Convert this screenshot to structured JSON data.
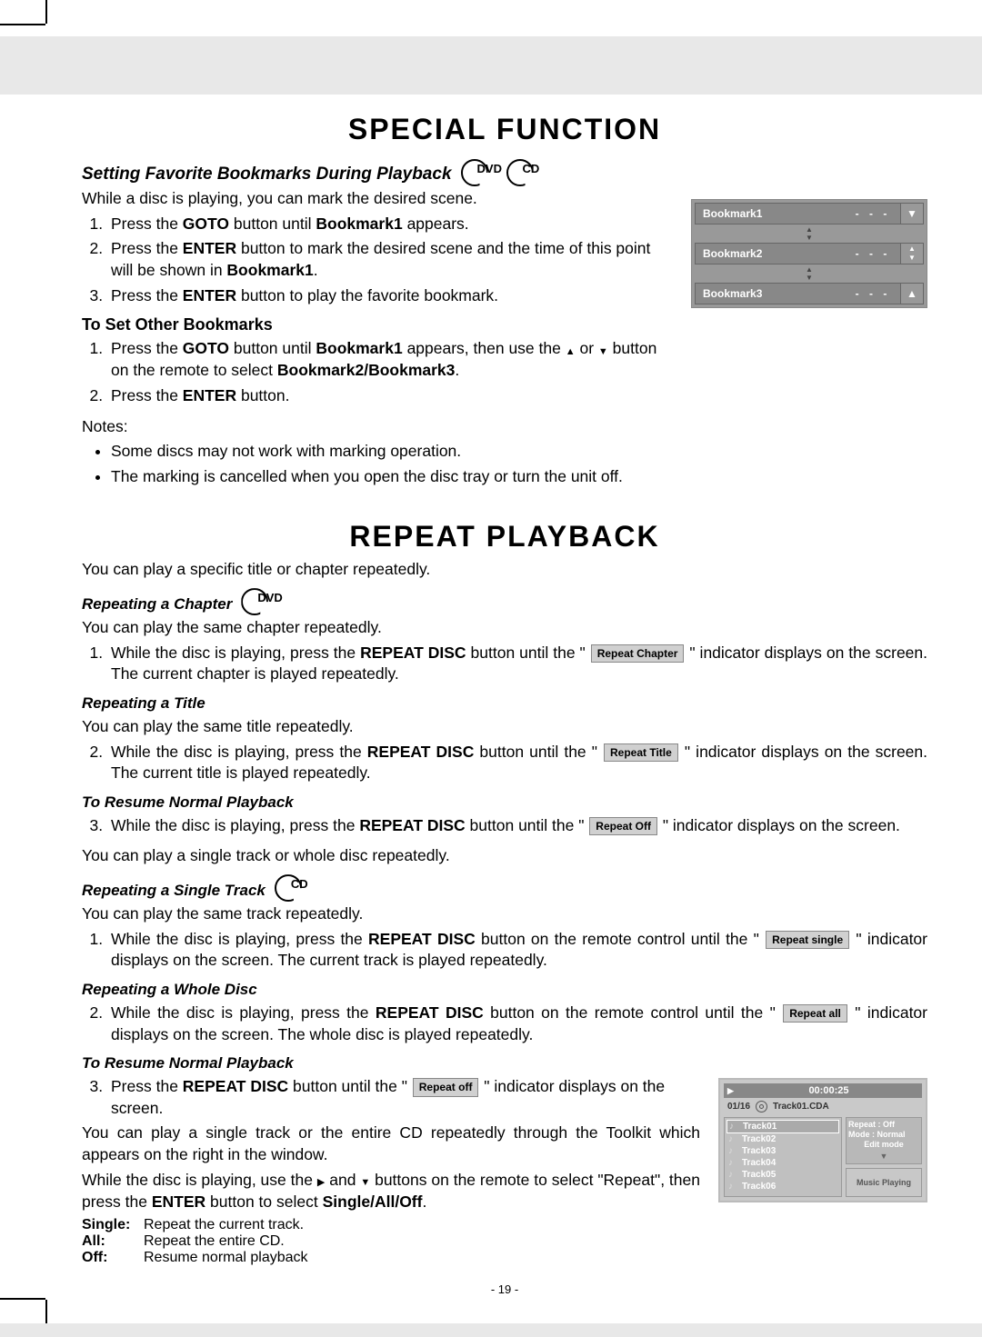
{
  "heading1": "SPECIAL FUNCTION",
  "bookmarks_section": {
    "title": "Setting Favorite Bookmarks During Playback",
    "icons": [
      "DVD",
      "CD"
    ],
    "intro": "While a disc is playing, you can mark the desired scene.",
    "steps": [
      {
        "pre": "Press the ",
        "b1": "GOTO",
        "mid1": " button until ",
        "b2": "Bookmark1",
        "post": " appears."
      },
      {
        "pre": "Press the ",
        "b1": "ENTER",
        "mid1": " button to mark the desired scene and the time of this point will be shown in ",
        "b2": "Bookmark1",
        "post": "."
      },
      {
        "pre": "Press the ",
        "b1": "ENTER",
        "mid1": " button to play the favorite bookmark.",
        "b2": "",
        "post": ""
      }
    ],
    "other_title": "To Set Other Bookmarks",
    "other_steps": {
      "s1a": "Press the ",
      "s1b": "GOTO",
      "s1c": " button until ",
      "s1d": "Bookmark1",
      "s1e": " appears, then use the ",
      "s1f": " or ",
      "s1g": " button on the remote to select ",
      "s1h": "Bookmark2/Bookmark3",
      "s1i": ".",
      "s2a": "Press the ",
      "s2b": "ENTER",
      "s2c": " button."
    },
    "notes_label": "Notes:",
    "notes": [
      "Some discs may not work with marking operation.",
      "The marking is cancelled when you open the disc tray or turn the unit off."
    ],
    "osd": {
      "rows": [
        {
          "name": "Bookmark1",
          "val": "- - -"
        },
        {
          "name": "Bookmark2",
          "val": "- - -"
        },
        {
          "name": "Bookmark3",
          "val": "- - -"
        }
      ]
    }
  },
  "heading2": "REPEAT PLAYBACK",
  "repeat": {
    "intro": "You can play a specific title or chapter repeatedly.",
    "chapter_title": "Repeating a Chapter",
    "chapter_icon": "DVD",
    "chapter_intro": "You can play the same chapter repeatedly.",
    "chapter_step_a": "While the disc is playing, press the ",
    "chapter_step_b": "REPEAT DISC",
    "chapter_step_c": " button until the \" ",
    "chapter_box": "Repeat  Chapter",
    "chapter_step_d": " \" indicator displays on the screen. The current chapter is played repeatedly.",
    "title_title": "Repeating a Title",
    "title_intro": "You can play the same title repeatedly.",
    "title_step_a": "While the disc is playing, press the ",
    "title_step_b": "REPEAT DISC",
    "title_step_c": " button until the \" ",
    "title_box": "Repeat  Title",
    "title_step_d": " \" indicator displays on the screen. The current title is played repeatedly.",
    "resume1_title": "To Resume Normal Playback",
    "resume1_a": "While the disc is playing, press the ",
    "resume1_b": "REPEAT DISC",
    "resume1_c": " button until the \" ",
    "resume1_box": "Repeat  Off",
    "resume1_d": " \" indicator displays on the screen.",
    "single_pre": "You can play a single track or whole disc repeatedly.",
    "single_title": "Repeating a Single Track",
    "single_icon": "CD",
    "single_intro": "You can play the same track repeatedly.",
    "single_a": "While the disc is playing, press the ",
    "single_b": "REPEAT DISC",
    "single_c": " button on the remote control until the \" ",
    "single_box": "Repeat  single",
    "single_d": " \" indicator displays on the screen. The current track is played repeatedly.",
    "whole_title": "Repeating a Whole Disc",
    "whole_a": "While the disc is playing, press the ",
    "whole_b": "REPEAT DISC",
    "whole_c": " button on the remote control until the \" ",
    "whole_box": "Repeat  all",
    "whole_d": " \" indicator displays on the screen. The whole disc is played repeatedly.",
    "resume2_title": "To Resume Normal Playback",
    "resume2_a": "Press the ",
    "resume2_b": "REPEAT DISC",
    "resume2_c": " button until the \" ",
    "resume2_box": "Repeat  off",
    "resume2_d": " \" indicator displays on the screen.",
    "toolkit_p": "You can play a single track or the entire CD repeatedly through the Toolkit which appears on the right in the window.",
    "toolkit2_a": "While the disc is playing, use the ",
    "toolkit2_b": " and ",
    "toolkit2_c": " buttons on the remote to select \"Repeat\", then press the ",
    "toolkit2_d": "ENTER",
    "toolkit2_e": " button to select ",
    "toolkit2_f": "Single/All/Off",
    "toolkit2_g": ".",
    "defs": [
      {
        "lab": "Single:",
        "txt": "Repeat the current track."
      },
      {
        "lab": "All:",
        "txt": "Repeat the entire CD."
      },
      {
        "lab": "Off:",
        "txt": "Resume normal playback"
      }
    ]
  },
  "toolkit_window": {
    "time": "00:00:25",
    "count": "01/16",
    "file": "Track01.CDA",
    "tracks": [
      "Track01",
      "Track02",
      "Track03",
      "Track04",
      "Track05",
      "Track06"
    ],
    "side_repeat": "Repeat : Off",
    "side_mode": "Mode    : Normal",
    "side_edit": "Edit mode",
    "side_status": "Music Playing"
  },
  "page_number": "- 19 -"
}
